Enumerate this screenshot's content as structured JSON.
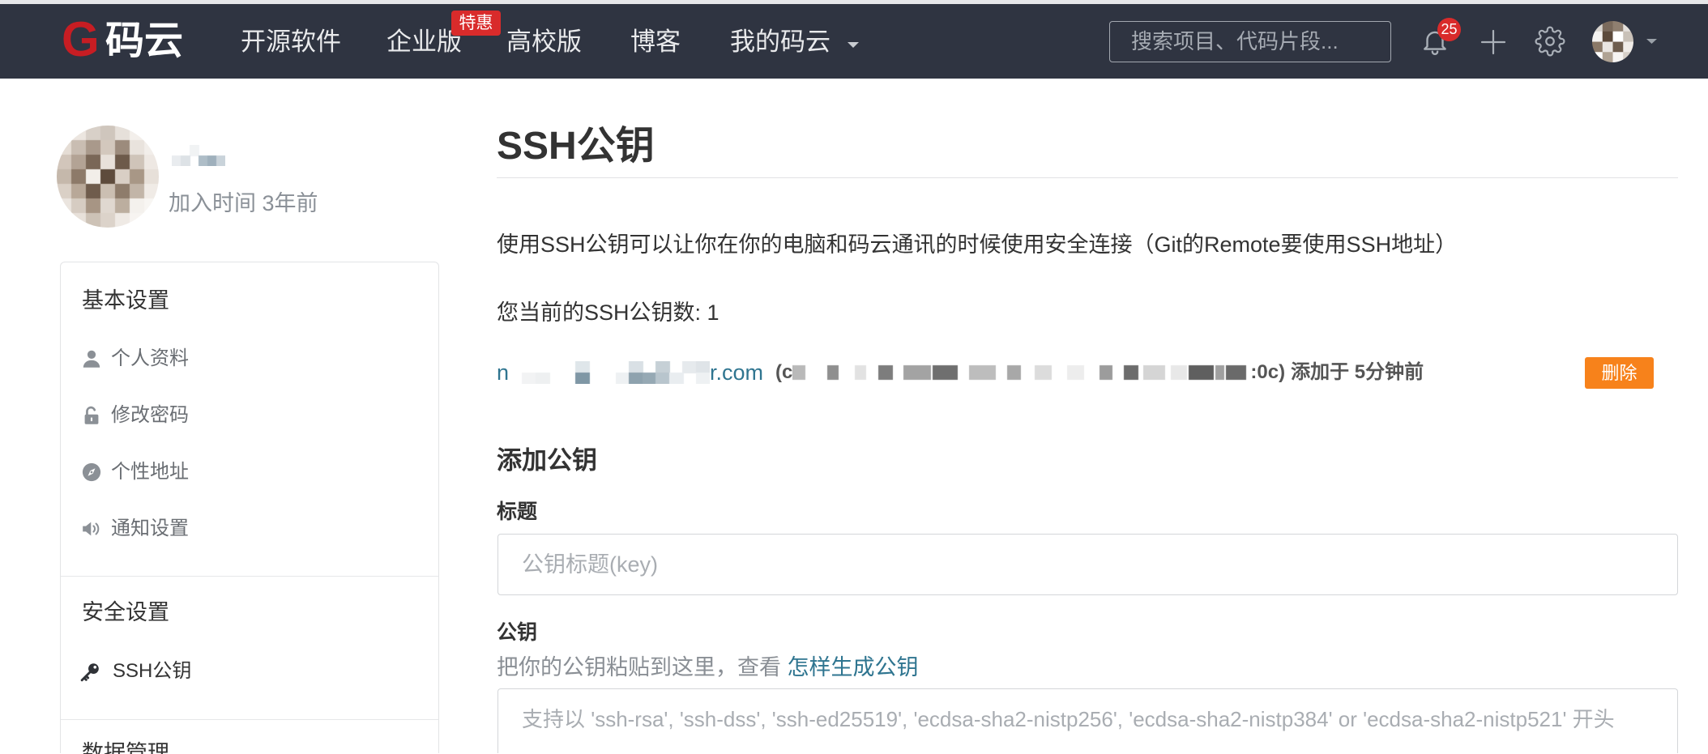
{
  "colors": {
    "navbar_bg": "#2f3441",
    "brand_red": "#c71d23",
    "badge_red": "#d92b2b",
    "link_teal": "#2f7590",
    "delete_orange": "#f7821b"
  },
  "header": {
    "logo": {
      "mark": "G",
      "text": "码云"
    },
    "nav": [
      {
        "label": "开源软件"
      },
      {
        "label": "企业版",
        "badge": "特惠"
      },
      {
        "label": "高校版"
      },
      {
        "label": "博客"
      },
      {
        "label": "我的码云",
        "icon": "chevron-down-icon"
      }
    ],
    "search": {
      "placeholder": "搜索项目、代码片段..."
    },
    "notifications": {
      "icon": "bell-icon",
      "count": "25"
    },
    "actions": [
      {
        "icon": "plus-icon"
      },
      {
        "icon": "gear-icon"
      }
    ],
    "user_menu": {
      "icon": "chevron-down-icon"
    }
  },
  "profile": {
    "joined": "加入时间 3年前"
  },
  "sidebar": {
    "sections": [
      {
        "title": "基本设置",
        "items": [
          {
            "label": "个人资料",
            "icon": "user-icon"
          },
          {
            "label": "修改密码",
            "icon": "unlock-icon"
          },
          {
            "label": "个性地址",
            "icon": "compass-icon"
          },
          {
            "label": "通知设置",
            "icon": "bullhorn-icon"
          }
        ]
      },
      {
        "title": "安全设置",
        "items": [
          {
            "label": "SSH公钥",
            "icon": "key-icon",
            "active": true
          }
        ]
      },
      {
        "title": "数据管理",
        "items": []
      }
    ]
  },
  "main": {
    "title": "SSH公钥",
    "description": "使用SSH公钥可以让你在你的电脑和码云通讯的时候使用安全连接（Git的Remote要使用SSH地址）",
    "key_count": "您当前的SSH公钥数: 1",
    "keys": [
      {
        "email_start": "n",
        "email_end": "r.com",
        "fingerprint_start": "(c",
        "fingerprint_end": ":0c)",
        "added": "添加于 5分钟前",
        "delete_label": "删除"
      }
    ],
    "add_form": {
      "heading": "添加公钥",
      "title_label": "标题",
      "title_placeholder": "公钥标题(key)",
      "key_label": "公钥",
      "key_help": "把你的公钥粘贴到这里，查看",
      "key_help_link": "怎样生成公钥",
      "key_placeholder": "支持以 'ssh-rsa', 'ssh-dss', 'ssh-ed25519', 'ecdsa-sha2-nistp256', 'ecdsa-sha2-nistp384' or 'ecdsa-sha2-nistp521' 开头"
    }
  }
}
